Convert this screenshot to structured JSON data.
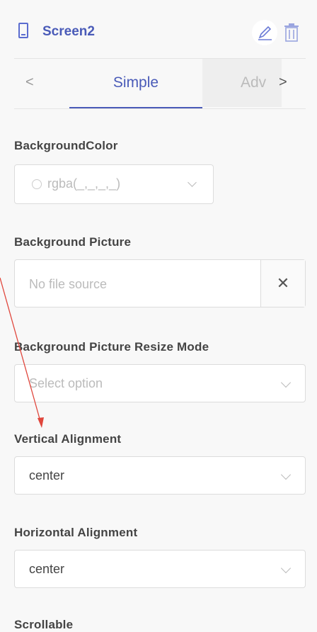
{
  "header": {
    "title": "Screen2",
    "icons": [
      "screen-icon",
      "pencil-icon",
      "trash-icon"
    ]
  },
  "tabs": {
    "prev": "<",
    "simple": "Simple",
    "advanced": "Adv",
    "next": ">"
  },
  "fields": {
    "background_color": {
      "label": "BackgroundColor",
      "value": "rgba(_,_,_,_)"
    },
    "background_picture": {
      "label": "Background Picture",
      "placeholder": "No file source",
      "clear": "✕"
    },
    "resize_mode": {
      "label": "Background Picture Resize Mode",
      "placeholder": "Select option"
    },
    "vertical_alignment": {
      "label": "Vertical Alignment",
      "value": "center"
    },
    "horizontal_alignment": {
      "label": "Horizontal Alignment",
      "value": "center"
    },
    "scrollable": {
      "label": "Scrollable"
    }
  },
  "colors": {
    "accent": "#4a5bb8",
    "annotation_arrow": "#e0463c"
  }
}
